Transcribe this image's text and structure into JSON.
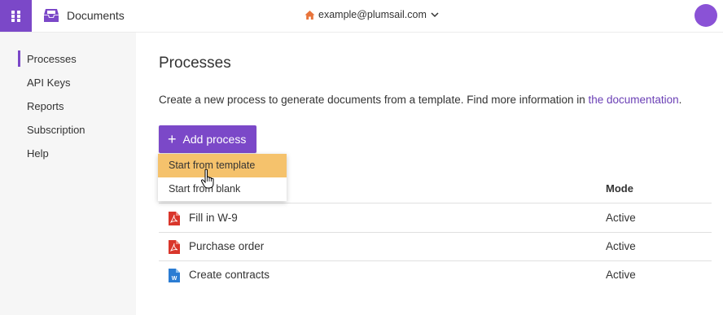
{
  "header": {
    "app_name": "Documents",
    "account_email": "example@plumsail.com",
    "colors": {
      "accent": "#7b48c8",
      "avatar": "#8a52d6"
    }
  },
  "sidebar": {
    "items": [
      {
        "label": "Processes",
        "active": true
      },
      {
        "label": "API Keys"
      },
      {
        "label": "Reports"
      },
      {
        "label": "Subscription"
      },
      {
        "label": "Help"
      }
    ]
  },
  "main": {
    "title": "Processes",
    "intro_text": "Create a new process to generate documents from a template. Find more information in ",
    "intro_link": "the documentation",
    "intro_end": ".",
    "add_button_label": "Add process",
    "dropdown": [
      {
        "label": "Start from template",
        "hovered": true
      },
      {
        "label": "Start from blank"
      }
    ],
    "table": {
      "mode_header": "Mode",
      "rows": [
        {
          "name": "Fill in W-9",
          "mode": "Active",
          "icon": "pdf-icon"
        },
        {
          "name": "Purchase order",
          "mode": "Active",
          "icon": "pdf-icon"
        },
        {
          "name": "Create contracts",
          "mode": "Active",
          "icon": "word-icon"
        }
      ]
    }
  }
}
